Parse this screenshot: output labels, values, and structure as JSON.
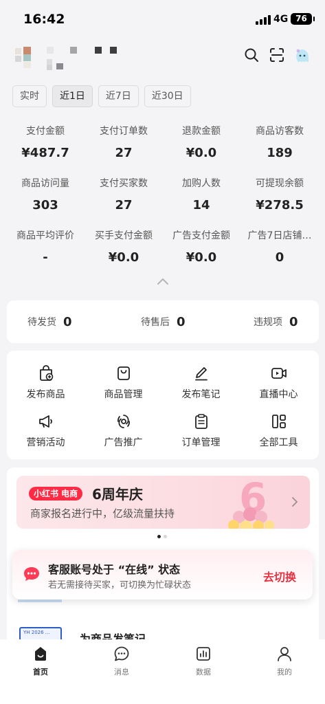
{
  "status_bar": {
    "time": "16:42",
    "network": "4G",
    "battery": "76"
  },
  "header": {
    "icons": [
      "search-icon",
      "scan-icon",
      "assistant-avatar-icon"
    ]
  },
  "date_tabs": [
    {
      "label": "实时",
      "active": false
    },
    {
      "label": "近1日",
      "active": true
    },
    {
      "label": "近7日",
      "active": false
    },
    {
      "label": "近30日",
      "active": false
    }
  ],
  "metrics": [
    {
      "label": "支付金额",
      "value": "¥487.7"
    },
    {
      "label": "支付订单数",
      "value": "27"
    },
    {
      "label": "退款金额",
      "value": "¥0.0"
    },
    {
      "label": "商品访客数",
      "value": "189"
    },
    {
      "label": "商品访问量",
      "value": "303"
    },
    {
      "label": "支付买家数",
      "value": "27"
    },
    {
      "label": "加购人数",
      "value": "14"
    },
    {
      "label": "可提现余额",
      "value": "¥278.5"
    },
    {
      "label": "商品平均评价",
      "value": "-"
    },
    {
      "label": "买手支付金额",
      "value": "¥0.0"
    },
    {
      "label": "广告支付金额",
      "value": "¥0.0"
    },
    {
      "label": "广告7日店铺…",
      "value": "0"
    }
  ],
  "pending": [
    {
      "label": "待发货",
      "value": "0"
    },
    {
      "label": "待售后",
      "value": "0"
    },
    {
      "label": "违规项",
      "value": "0"
    }
  ],
  "tools": [
    {
      "label": "发布商品",
      "icon": "publish-product-icon"
    },
    {
      "label": "商品管理",
      "icon": "product-bag-icon"
    },
    {
      "label": "发布笔记",
      "icon": "pen-icon"
    },
    {
      "label": "直播中心",
      "icon": "live-camera-icon"
    },
    {
      "label": "营销活动",
      "icon": "megaphone-icon"
    },
    {
      "label": "广告推广",
      "icon": "ad-promo-icon"
    },
    {
      "label": "订单管理",
      "icon": "clipboard-icon"
    },
    {
      "label": "全部工具",
      "icon": "grid-tools-icon"
    }
  ],
  "banner": {
    "brand": "小红书 电商",
    "title": "6周年庆",
    "subtitle": "商家报名进行中，亿级流量扶持",
    "page_index": 1,
    "page_count": 2
  },
  "notice": {
    "title": "客服账号处于 “在线” 状态",
    "subtitle": "若无需接待买家，可切换为忙碌状态",
    "action": "去切换"
  },
  "feed_peek": {
    "text": "为商品发笔记"
  },
  "tabbar": [
    {
      "label": "首页",
      "icon": "home-icon",
      "active": true
    },
    {
      "label": "消息",
      "icon": "message-icon",
      "active": false
    },
    {
      "label": "数据",
      "icon": "data-chart-icon",
      "active": false
    },
    {
      "label": "我的",
      "icon": "profile-icon",
      "active": false
    }
  ],
  "colors": {
    "accent": "#e8303f",
    "brand_red": "#ff2a44",
    "background": "#f4f4f6"
  }
}
